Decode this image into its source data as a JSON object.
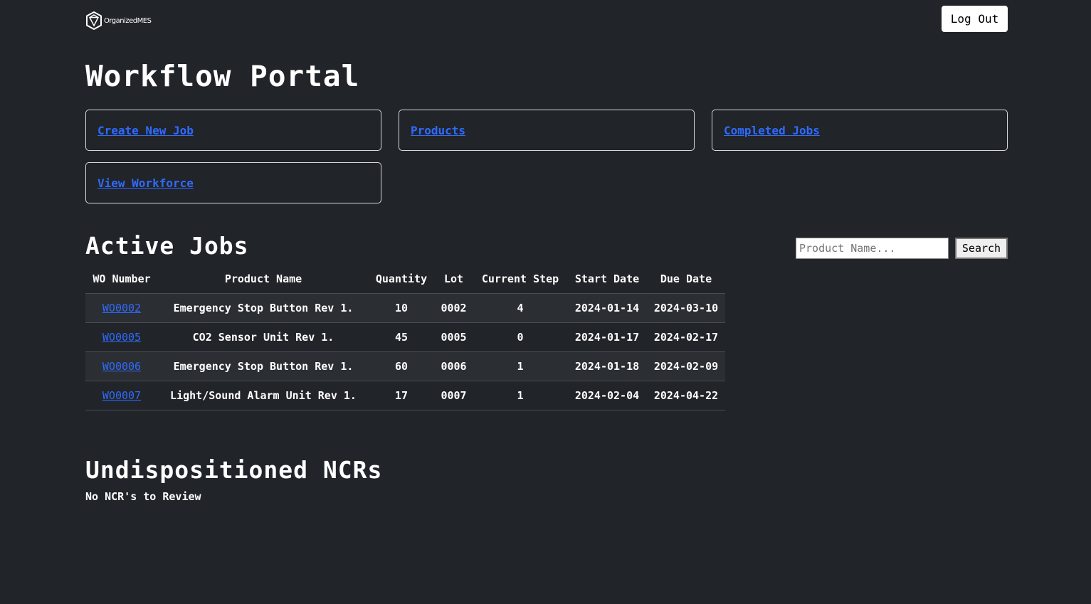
{
  "header": {
    "logo_text": "OrganizedMES",
    "logout_label": "Log Out"
  },
  "page_title": "Workflow Portal",
  "nav_links": [
    {
      "label": "Create New Job"
    },
    {
      "label": "Products"
    },
    {
      "label": "Completed Jobs"
    },
    {
      "label": "View Workforce"
    }
  ],
  "active_jobs": {
    "heading": "Active Jobs",
    "search": {
      "placeholder": "Product Name...",
      "value": "",
      "button_label": "Search"
    },
    "columns": [
      "WO Number",
      "Product Name",
      "Quantity",
      "Lot",
      "Current Step",
      "Start Date",
      "Due Date"
    ],
    "rows": [
      {
        "wo": "WO0002",
        "product": "Emergency Stop Button Rev 1.",
        "quantity": "10",
        "lot": "0002",
        "step": "4",
        "start": "2024-01-14",
        "due": "2024-03-10"
      },
      {
        "wo": "WO0005",
        "product": "CO2 Sensor Unit Rev 1.",
        "quantity": "45",
        "lot": "0005",
        "step": "0",
        "start": "2024-01-17",
        "due": "2024-02-17"
      },
      {
        "wo": "WO0006",
        "product": "Emergency Stop Button Rev 1.",
        "quantity": "60",
        "lot": "0006",
        "step": "1",
        "start": "2024-01-18",
        "due": "2024-02-09"
      },
      {
        "wo": "WO0007",
        "product": "Light/Sound Alarm Unit Rev 1.",
        "quantity": "17",
        "lot": "0007",
        "step": "1",
        "start": "2024-02-04",
        "due": "2024-04-22"
      }
    ]
  },
  "ncrs": {
    "heading": "Undispositioned NCRs",
    "empty_message": "No NCR's to Review"
  },
  "colors": {
    "background": "#212429",
    "link": "#2f6bff",
    "text": "#ffffff"
  }
}
